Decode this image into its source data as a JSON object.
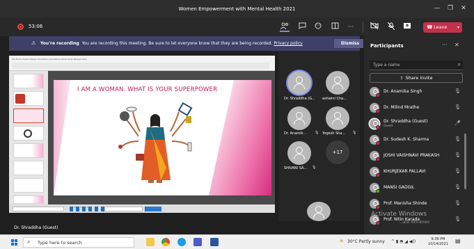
{
  "window": {
    "title": "Women Empowerment with Mental Health 2021"
  },
  "meeting": {
    "timer": "53:06",
    "leave_label": "Leave"
  },
  "banner": {
    "bold": "You're recording",
    "message": "You are recording this meeting. Be sure to let everyone know that they are being recorded.",
    "link": "Privacy policy",
    "dismiss_label": "Dismiss"
  },
  "slide": {
    "title": "I AM A WOMAN.  WHAT IS YOUR SUPERPOWER"
  },
  "tiles": [
    {
      "name": "Dr. Shraddha (G..."
    },
    {
      "name": "ashwini Cha..."
    },
    {
      "name": "Dr. Anamik..."
    },
    {
      "name": "Yogesh Sha..."
    },
    {
      "name": "SHIVANI SA..."
    }
  ],
  "more_count": "+17",
  "spotlight_name": "Dr. Shraddha (Guest)",
  "panel": {
    "title": "Participants",
    "search_placeholder": "Type a name",
    "share_invite": "Share invite",
    "participants": [
      {
        "name": "Dr. Anamika Singh",
        "status": "busy",
        "muted": true
      },
      {
        "name": "Dr. Milind Mrathe",
        "status": "busy",
        "muted": true
      },
      {
        "name": "Dr. Shraddha (Guest)",
        "sub": "Guest",
        "status": "busy",
        "muted": false
      },
      {
        "name": "Dr. Sudesh K. Sharma",
        "status": "busy",
        "muted": true
      },
      {
        "name": "JOSHI VAISHNAVI PRAKASH",
        "status": "busy",
        "muted": true
      },
      {
        "name": "KHURJEKAR PALLAVI",
        "status": "busy",
        "muted": true
      },
      {
        "name": "MANSI GADGIL",
        "status": "available",
        "muted": true
      },
      {
        "name": "Prof. Manisha Shinde",
        "status": "busy",
        "muted": true
      },
      {
        "name": "Prof. Nitin Karade",
        "status": "busy",
        "muted": true
      }
    ]
  },
  "watermark": {
    "line1": "Activate Windows",
    "line2": "...ate Windows"
  },
  "taskbar": {
    "search_placeholder": "Type here to search",
    "weather": "30°C  Partly sunny",
    "time": "9:39 PM",
    "date": "10/14/2021"
  },
  "colors": {
    "accent": "#7b83eb",
    "leave": "#c4314b",
    "banner": "#3f3f67",
    "slide_title": "#c2185b"
  }
}
